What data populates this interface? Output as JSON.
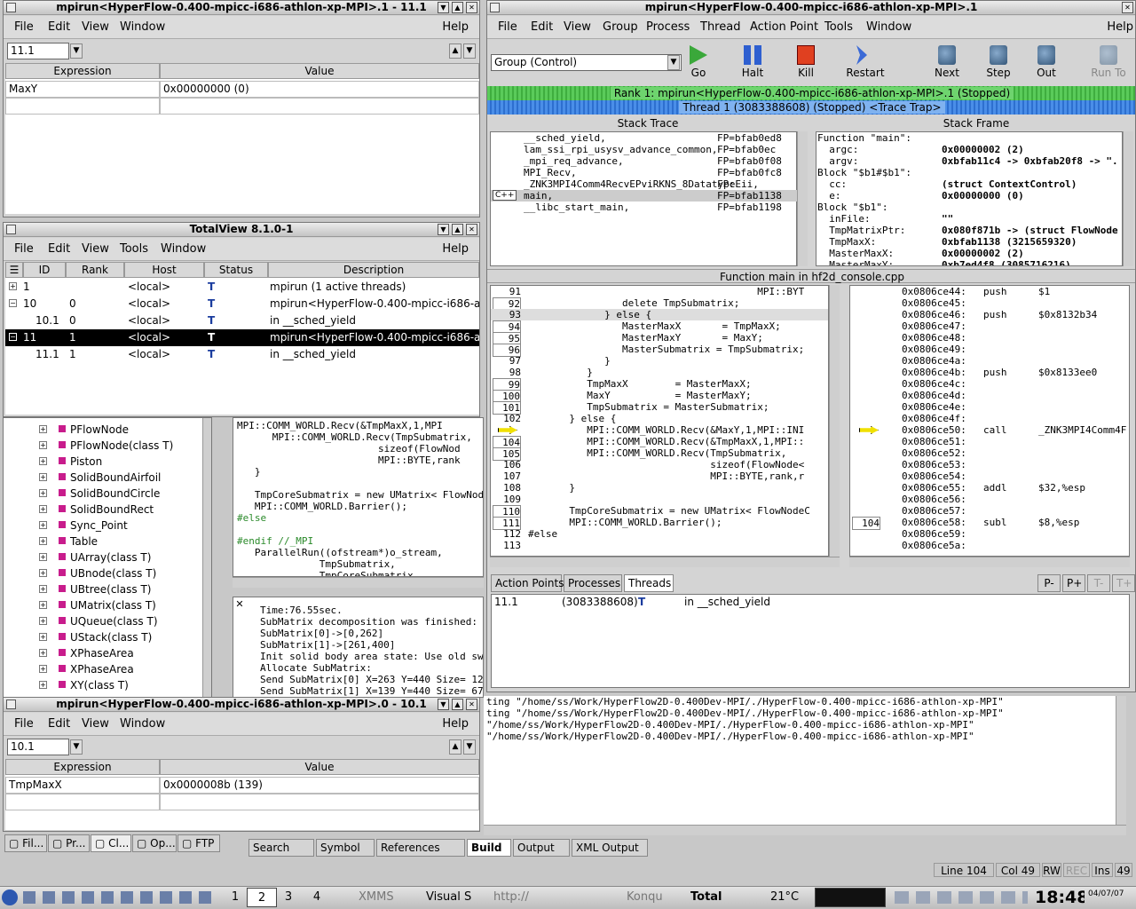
{
  "expr_win_top": {
    "title": "mpirun<HyperFlow-0.400-mpicc-i686-athlon-xp-MPI>.1 - 11.1",
    "menus": [
      "File",
      "Edit",
      "View",
      "Window"
    ],
    "help": "Help",
    "thread_field": "11.1",
    "col_expression": "Expression",
    "col_value": "Value",
    "rows": [
      {
        "expr": "MaxY",
        "value": "0x00000000 (0)"
      }
    ]
  },
  "root_win": {
    "title": "TotalView 8.1.0-1",
    "menus": [
      "File",
      "Edit",
      "View",
      "Tools",
      "Window"
    ],
    "help": "Help",
    "columns": [
      "ID",
      "Rank",
      "Host",
      "Status",
      "Description"
    ],
    "rows": [
      {
        "id": "1",
        "rank": "",
        "host": "<local>",
        "status": "T",
        "desc": "mpirun (1 active threads)"
      },
      {
        "id": "10",
        "rank": "0",
        "host": "<local>",
        "status": "T",
        "desc": "mpirun<HyperFlow-0.400-mpicc-i686-at"
      },
      {
        "id": "10.1",
        "rank": "0",
        "host": "<local>",
        "status": "T",
        "desc": "in __sched_yield"
      },
      {
        "id": "11",
        "rank": "1",
        "host": "<local>",
        "status": "T",
        "desc": "mpirun<HyperFlow-0.400-mpicc-i686-at"
      },
      {
        "id": "11.1",
        "rank": "1",
        "host": "<local>",
        "status": "T",
        "desc": "in __sched_yield"
      }
    ]
  },
  "class_tree": [
    "PFlowNode",
    "PFlowNode(class T)",
    "Piston",
    "SolidBoundAirfoil",
    "SolidBoundCircle",
    "SolidBoundRect",
    "Sync_Point",
    "Table",
    "UArray(class T)",
    "UBnode(class T)",
    "UBtree(class T)",
    "UMatrix(class T)",
    "UQueue(class T)",
    "UStack(class T)",
    "XPhaseArea",
    "XPhaseArea",
    "XY(class T)"
  ],
  "ide_code": [
    "MPI::COMM_WORLD.Recv(&TmpMaxX,1,MPI",
    "      MPI::COMM_WORLD.Recv(TmpSubmatrix,",
    "                        sizeof(FlowNod",
    "                        MPI::BYTE,rank",
    "   }",
    "",
    "   TmpCoreSubmatrix = new UMatrix< FlowNod",
    "   MPI::COMM_WORLD.Barrier();",
    "#else",
    "",
    "#endif //_MPI",
    "   ParallelRun((ofstream*)o_stream,",
    "              TmpSubmatrix,",
    "              TmpCoreSubmatrix,"
  ],
  "ide_output": [
    "Time:76.55sec.",
    "SubMatrix decomposition was finished:",
    "SubMatrix[0]->[0,262]",
    "SubMatrix[1]->[261,400]",
    "Init solid body area state: Use old swap f",
    "Allocate SubMatrix:",
    "Send SubMatrix[0] X=263 Y=440 Size= 127+23",
    "Send SubMatrix[1] X=139 Y=440 Size= 67+12"
  ],
  "expr_win_bottom": {
    "title": "mpirun<HyperFlow-0.400-mpicc-i686-athlon-xp-MPI>.0 - 10.1",
    "menus": [
      "File",
      "Edit",
      "View",
      "Window"
    ],
    "help": "Help",
    "thread_field": "10.1",
    "col_expression": "Expression",
    "col_value": "Value",
    "rows": [
      {
        "expr": "TmpMaxX",
        "value": "0x0000008b (139)"
      }
    ]
  },
  "bottom_tabs": [
    "Fil...",
    "Pr...",
    "Cl...",
    "Op...",
    "FTP"
  ],
  "ide_tabs": [
    "Search",
    "Symbol",
    "References",
    "Build",
    "Output",
    "XML Output"
  ],
  "build_lines": [
    "ting \"/home/ss/Work/HyperFlow2D-0.400Dev-MPI/./HyperFlow-0.400-mpicc-i686-athlon-xp-MPI\"",
    "ting \"/home/ss/Work/HyperFlow2D-0.400Dev-MPI/./HyperFlow-0.400-mpicc-i686-athlon-xp-MPI\"",
    "\"/home/ss/Work/HyperFlow2D-0.400Dev-MPI/./HyperFlow-0.400-mpicc-i686-athlon-xp-MPI\"",
    "\"/home/ss/Work/HyperFlow2D-0.400Dev-MPI/./HyperFlow-0.400-mpicc-i686-athlon-xp-MPI\""
  ],
  "ide_status": {
    "line": "Line 104",
    "col": "Col 49",
    "rw": "RW",
    "rec": "REC",
    "ins": "Ins",
    "num": "49"
  },
  "proc_win": {
    "title": "mpirun<HyperFlow-0.400-mpicc-i686-athlon-xp-MPI>.1",
    "menus": [
      "File",
      "Edit",
      "View",
      "Group",
      "Process",
      "Thread",
      "Action Point",
      "Tools",
      "Window"
    ],
    "help": "Help",
    "group": "Group (Control)",
    "tools": [
      "Go",
      "Halt",
      "Kill",
      "Restart",
      "Next",
      "Step",
      "Out",
      "Run To"
    ],
    "rank_bar": "Rank 1: mpirun<HyperFlow-0.400-mpicc-i686-athlon-xp-MPI>.1 (Stopped)",
    "thread_bar": "Thread 1 (3083388608) (Stopped) <Trace Trap>",
    "stack_trace_title": "Stack Trace",
    "stack_frame_title": "Stack Frame",
    "stack": [
      {
        "fn": "__sched_yield,",
        "fp": "FP=bfab0ed8"
      },
      {
        "fn": "lam_ssi_rpi_usysv_advance_common,",
        "fp": "FP=bfab0ec"
      },
      {
        "fn": "_mpi_req_advance,",
        "fp": "FP=bfab0f08"
      },
      {
        "fn": "MPI_Recv,",
        "fp": "FP=bfab0fc8"
      },
      {
        "fn": "_ZNK3MPI4Comm4RecvEPviRKNS_8DatatypeEii,",
        "fp": "FP:"
      },
      {
        "fn": "main,",
        "fp": "FP=bfab1138",
        "lang": "C++"
      },
      {
        "fn": "__libc_start_main,",
        "fp": "FP=bfab1198"
      }
    ],
    "frame": [
      {
        "k": "Function \"main\":",
        "v": ""
      },
      {
        "k": "  argc:",
        "v": "0x00000002 (2)"
      },
      {
        "k": "  argv:",
        "v": "0xbfab11c4 -> 0xbfab20f8 -> \"."
      },
      {
        "k": "Block \"$b1#$b1\":",
        "v": ""
      },
      {
        "k": "  cc:",
        "v": "(struct ContextControl)"
      },
      {
        "k": "  e:",
        "v": "0x00000000 (0)"
      },
      {
        "k": "Block \"$b1\":",
        "v": ""
      },
      {
        "k": "  inFile:",
        "v": "\"\""
      },
      {
        "k": "  TmpMatrixPtr:",
        "v": "0x080f871b -> (struct FlowNode"
      },
      {
        "k": "  TmpMaxX:",
        "v": "0xbfab1138 (3215659320)"
      },
      {
        "k": "  MasterMaxX:",
        "v": "0x00000002 (2)"
      },
      {
        "k": "  MasterMaxY:",
        "v": "0xb7ed4f8 (3085716216)"
      }
    ],
    "source_title": "Function main in hf2d_console.cpp",
    "source": [
      {
        "n": "91",
        "t": "                                       MPI::BYT"
      },
      {
        "n": "92",
        "t": "                delete TmpSubmatrix;"
      },
      {
        "n": "93",
        "t": "             } else {"
      },
      {
        "n": "94",
        "t": "                MasterMaxX       = TmpMaxX;"
      },
      {
        "n": "95",
        "t": "                MasterMaxY       = MaxY;"
      },
      {
        "n": "96",
        "t": "                MasterSubmatrix = TmpSubmatrix;"
      },
      {
        "n": "97",
        "t": "             }"
      },
      {
        "n": "98",
        "t": "          }"
      },
      {
        "n": "99",
        "t": "          TmpMaxX        = MasterMaxX;"
      },
      {
        "n": "100",
        "t": "          MaxY           = MasterMaxY;"
      },
      {
        "n": "101",
        "t": "          TmpSubmatrix = MasterSubmatrix;"
      },
      {
        "n": "102",
        "t": "       } else {"
      },
      {
        "n": "",
        "t": "          MPI::COMM_WORLD.Recv(&MaxY,1,MPI::INI"
      },
      {
        "n": "104",
        "t": "          MPI::COMM_WORLD.Recv(&TmpMaxX,1,MPI::"
      },
      {
        "n": "105",
        "t": "          MPI::COMM_WORLD.Recv(TmpSubmatrix,"
      },
      {
        "n": "106",
        "t": "                               sizeof(FlowNode<"
      },
      {
        "n": "107",
        "t": "                               MPI::BYTE,rank,r"
      },
      {
        "n": "108",
        "t": "       }"
      },
      {
        "n": "109",
        "t": ""
      },
      {
        "n": "110",
        "t": "       TmpCoreSubmatrix = new UMatrix< FlowNodeC"
      },
      {
        "n": "111",
        "t": "       MPI::COMM_WORLD.Barrier();"
      },
      {
        "n": "112",
        "t": "#else"
      },
      {
        "n": "113",
        "t": ""
      }
    ],
    "asm": [
      {
        "a": "0x0806ce44:",
        "i": "push",
        "o": "$1"
      },
      {
        "a": "0x0806ce45:",
        "i": "",
        "o": ""
      },
      {
        "a": "0x0806ce46:",
        "i": "push",
        "o": "$0x8132b34"
      },
      {
        "a": "0x0806ce47:",
        "i": "",
        "o": ""
      },
      {
        "a": "0x0806ce48:",
        "i": "",
        "o": ""
      },
      {
        "a": "0x0806ce49:",
        "i": "",
        "o": ""
      },
      {
        "a": "0x0806ce4a:",
        "i": "",
        "o": ""
      },
      {
        "a": "0x0806ce4b:",
        "i": "push",
        "o": "$0x8133ee0"
      },
      {
        "a": "0x0806ce4c:",
        "i": "",
        "o": ""
      },
      {
        "a": "0x0806ce4d:",
        "i": "",
        "o": ""
      },
      {
        "a": "0x0806ce4e:",
        "i": "",
        "o": ""
      },
      {
        "a": "0x0806ce4f:",
        "i": "",
        "o": ""
      },
      {
        "a": "0x0806ce50:",
        "i": "call",
        "o": "_ZNK3MPI4Comm4F"
      },
      {
        "a": "0x0806ce51:",
        "i": "",
        "o": ""
      },
      {
        "a": "0x0806ce52:",
        "i": "",
        "o": ""
      },
      {
        "a": "0x0806ce53:",
        "i": "",
        "o": ""
      },
      {
        "a": "0x0806ce54:",
        "i": "",
        "o": ""
      },
      {
        "a": "0x0806ce55:",
        "i": "addl",
        "o": "$32,%esp"
      },
      {
        "a": "0x0806ce56:",
        "i": "",
        "o": ""
      },
      {
        "a": "0x0806ce57:",
        "i": "",
        "o": ""
      },
      {
        "a": "0x0806ce58:",
        "i": "subl",
        "o": "$8,%esp"
      },
      {
        "a": "0x0806ce59:",
        "i": "",
        "o": ""
      },
      {
        "a": "0x0806ce5a:",
        "i": "",
        "o": ""
      }
    ],
    "asm_bp": "104",
    "bottom_tabs": [
      "Action Points",
      "Processes",
      "Threads"
    ],
    "pbtn": [
      "P-",
      "P+",
      "T-",
      "T+"
    ],
    "thread_line": {
      "id": "11.1",
      "tid": "(3083388608)",
      "st": "T",
      "loc": "in __sched_yield"
    }
  },
  "taskbar": {
    "desks": [
      "1",
      "2",
      "3",
      "4"
    ],
    "apps": [
      "XMMS",
      "Visual S",
      "http://",
      "Konqu",
      "Total"
    ],
    "temp": "21°C",
    "time": "18:48",
    "date": "04/07/07"
  }
}
